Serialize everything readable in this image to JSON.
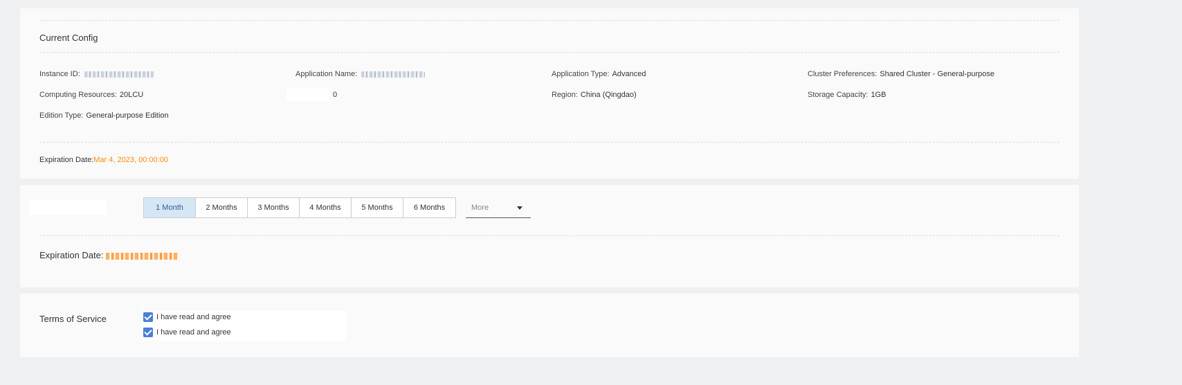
{
  "current_config": {
    "title": "Current Config",
    "fields": {
      "instance_id": {
        "label": "Instance ID:",
        "value": ""
      },
      "application_name": {
        "label": "Application Name:",
        "value": ""
      },
      "application_type": {
        "label": "Application Type:",
        "value": "Advanced"
      },
      "cluster_preferences": {
        "label": "Cluster Preferences:",
        "value": "Shared Cluster - General-purpose"
      },
      "computing_resources": {
        "label": "Computing Resources:",
        "value": "20LCU"
      },
      "unlabeled_value": {
        "label": "",
        "value": "0"
      },
      "region": {
        "label": "Region:",
        "value": "China (Qingdao)"
      },
      "storage_capacity": {
        "label": "Storage Capacity:",
        "value": "1GB"
      },
      "edition_type": {
        "label": "Edition Type:",
        "value": "General-purpose Edition"
      }
    },
    "expiration": {
      "label": "Expiration Date:",
      "value": "Mar 4, 2023, 00:00:00"
    }
  },
  "duration": {
    "tabs": [
      {
        "label": "1 Month",
        "active": true
      },
      {
        "label": "2 Months"
      },
      {
        "label": "3 Months"
      },
      {
        "label": "4 Months"
      },
      {
        "label": "5 Months"
      },
      {
        "label": "6 Months"
      }
    ],
    "more_placeholder": "More",
    "expiration_label": "Expiration Date:"
  },
  "terms": {
    "title": "Terms of Service",
    "agreements": [
      {
        "label": "I have read and agree",
        "checked": true
      },
      {
        "label": "I have read and agree",
        "checked": true
      }
    ]
  },
  "colors": {
    "accent": "#4a7fd6",
    "highlight": "#ff8a00",
    "active_tab": "#d5e6f5"
  }
}
